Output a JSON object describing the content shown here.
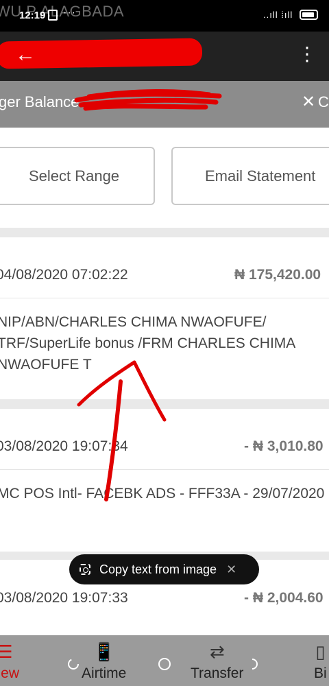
{
  "status_bar": {
    "carrier": "WU P ALAGBADA",
    "time": "12:19",
    "more": "···",
    "signal": "..ıll ⁞ıll"
  },
  "app_bar": {
    "back": "←",
    "menu": "⋮"
  },
  "balance_bar": {
    "label": "ger Balance. :",
    "close": "✕",
    "close_suffix": "C"
  },
  "actions": {
    "select_range": "Select Range",
    "email_statement": "Email Statement"
  },
  "transactions": [
    {
      "date": "04/08/2020 07:02:22",
      "amount": "₦ 175,420.00",
      "description": "NIP/ABN/CHARLES CHIMA NWAOFUFE/ TRF/SuperLife bonus /FRM CHARLES CHIMA NWAOFUFE T"
    },
    {
      "date": "03/08/2020 19:07:34",
      "amount": "- ₦ 3,010.80",
      "description": "MC POS Intl- FACEBK ADS - FFF33A - 29/07/2020"
    },
    {
      "date": "03/08/2020 19:07:33",
      "amount": "- ₦ 2,004.60",
      "description": ""
    }
  ],
  "toast": {
    "text": "Copy text from image",
    "close": "✕"
  },
  "edit_bar": {
    "icons": [
      "share-icon",
      "sliders-icon",
      "lens-icon",
      "trash-icon"
    ]
  },
  "bottom_nav": {
    "view": "view",
    "airtime": "Airtime",
    "transfer": "Transfer",
    "bi": "Bi"
  },
  "colors": {
    "redaction": "#e00000",
    "accent": "#c71313",
    "toast_bg": "#121212"
  }
}
